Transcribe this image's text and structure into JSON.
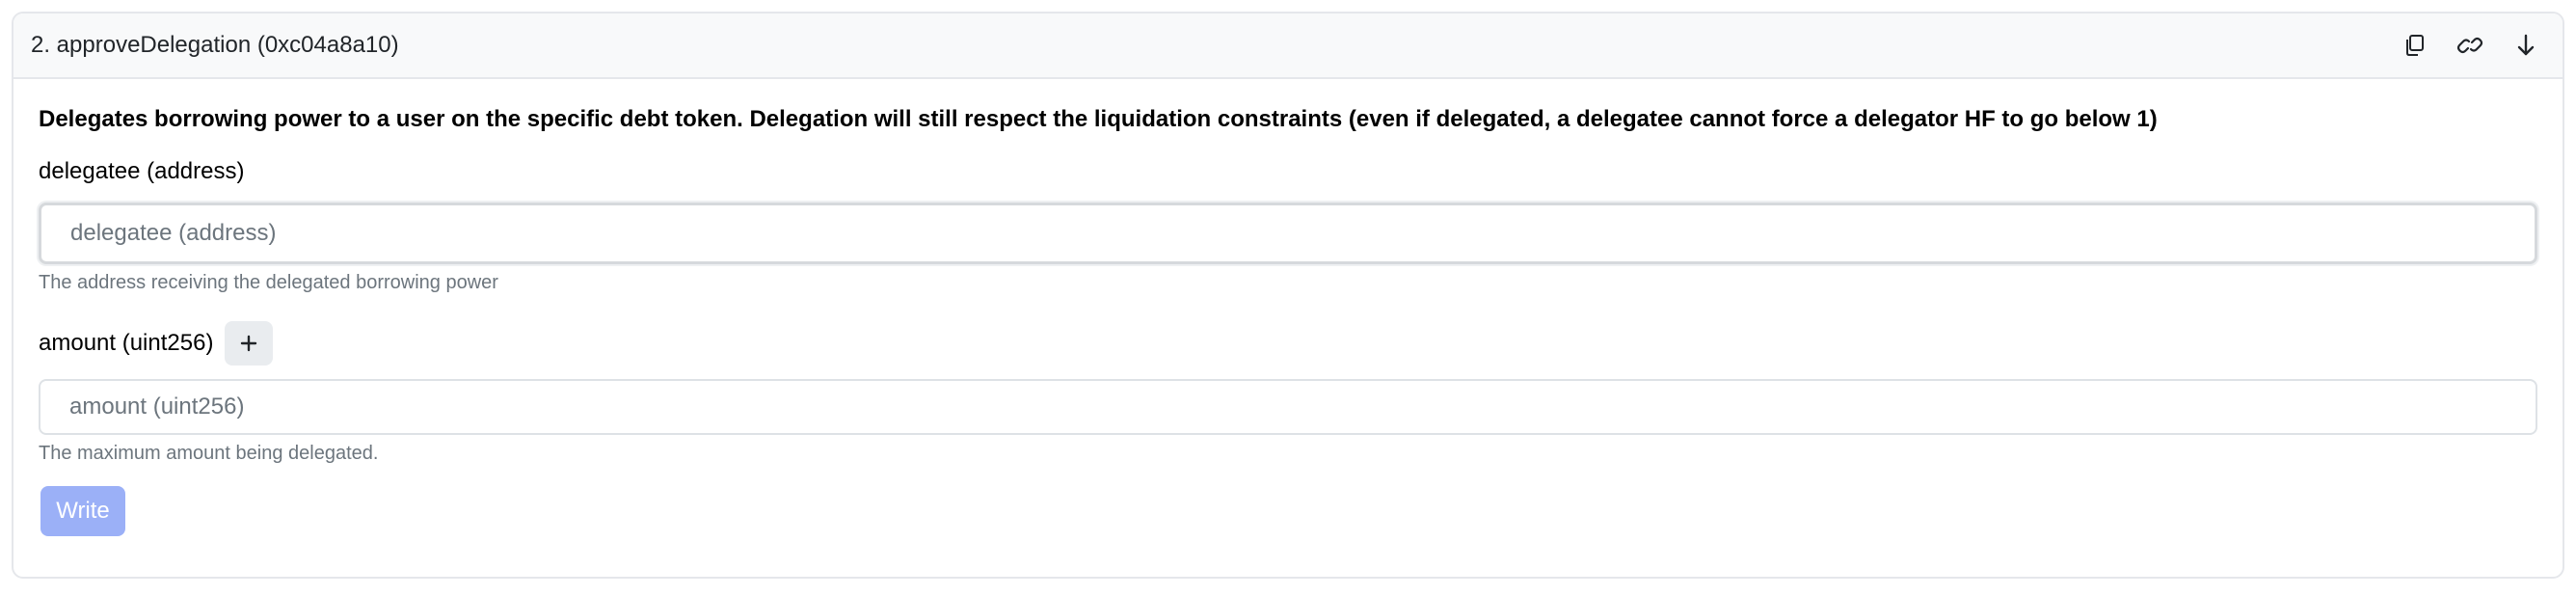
{
  "header": {
    "title": "2. approveDelegation (0xc04a8a10)",
    "actions": [
      {
        "icon": "copy-icon"
      },
      {
        "icon": "link-icon"
      },
      {
        "icon": "arrow-down-icon"
      }
    ]
  },
  "description": "Delegates borrowing power to a user on the specific debt token. Delegation will still respect the liquidation constraints (even if delegated, a delegatee cannot force a delegator HF to go below 1)",
  "fields": [
    {
      "label": "delegatee (address)",
      "value": "",
      "placeholder": "delegatee (address)",
      "help": "The address receiving the delegated borrowing power"
    },
    {
      "label": "amount (uint256)",
      "plus_label": "+",
      "value": "",
      "placeholder": "amount (uint256)",
      "help": "The maximum amount being delegated."
    }
  ],
  "write_label": "Write",
  "colors": {
    "write_button_bg": "#9bb0f7",
    "header_bg": "#f8f9fa",
    "border": "#e5e7eb"
  }
}
